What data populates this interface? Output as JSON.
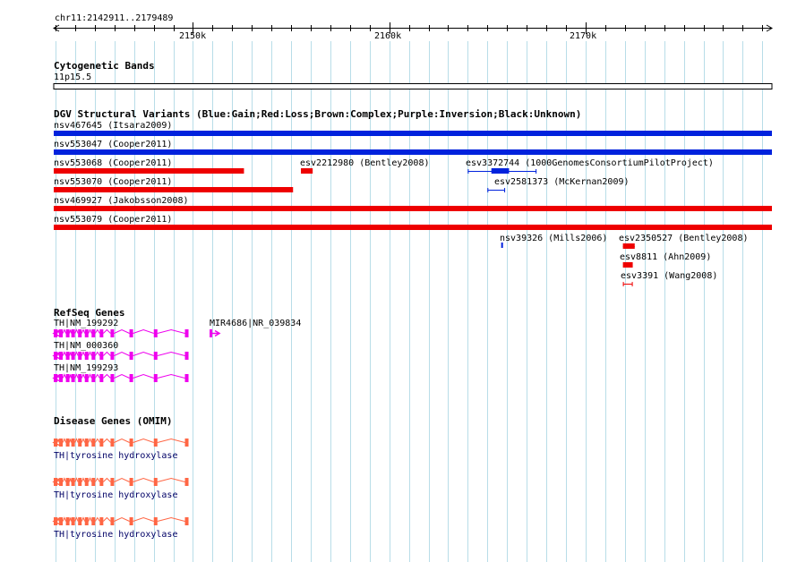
{
  "locus": "chr11:2142911..2179489",
  "ruler": {
    "start": 2142911,
    "end": 2179489,
    "ticks": [
      {
        "pos": 2150000,
        "label": "2150k"
      },
      {
        "pos": 2160000,
        "label": "2160k"
      },
      {
        "pos": 2170000,
        "label": "2170k"
      }
    ]
  },
  "cytoband": {
    "title": "Cytogenetic Bands",
    "label": "11p15.5"
  },
  "dgv": {
    "title": "DGV Structural Variants (Blue:Gain;Red:Loss;Brown:Complex;Purple:Inversion;Black:Unknown)",
    "colors": {
      "gain": "#0022dd",
      "loss": "#ee0000"
    },
    "features": [
      {
        "label": "nsv467645 (Itsara2009)",
        "type": "gain",
        "start": 2142911,
        "end": 2179489
      },
      {
        "label": "nsv553047 (Cooper2011)",
        "type": "gain",
        "start": 2142911,
        "end": 2179489
      },
      {
        "label": "nsv553068 (Cooper2011)",
        "type": "loss",
        "start": 2142911,
        "end": 2152600
      },
      {
        "label": "esv2212980 (Bentley2008)",
        "type": "loss",
        "start": 2155500,
        "end": 2156100
      },
      {
        "label": "esv3372744 (1000GenomesConsortiumPilotProject)",
        "type": "gain",
        "start": 2164000,
        "end": 2167500
      },
      {
        "label": "nsv553070 (Cooper2011)",
        "type": "loss",
        "start": 2142911,
        "end": 2155100
      },
      {
        "label": "esv2581373 (McKernan2009)",
        "type": "gain",
        "start": 2165000,
        "end": 2165900
      },
      {
        "label": "nsv469927 (Jakobsson2008)",
        "type": "loss",
        "start": 2142911,
        "end": 2179489
      },
      {
        "label": "nsv553079 (Cooper2011)",
        "type": "loss",
        "start": 2142911,
        "end": 2179489
      },
      {
        "label": "nsv39326 (Mills2006)",
        "type": "gain",
        "start": 2165700,
        "end": 2165760
      },
      {
        "label": "esv2350527 (Bentley2008)",
        "type": "loss",
        "start": 2171900,
        "end": 2172500
      },
      {
        "label": "esv8811 (Ahn2009)",
        "type": "loss",
        "start": 2171900,
        "end": 2172400
      },
      {
        "label": "esv3391 (Wang2008)",
        "type": "loss",
        "start": 2171900,
        "end": 2172400
      }
    ]
  },
  "refseq": {
    "title": "RefSeq Genes",
    "color": "#ee00ee",
    "genes": [
      {
        "label": "TH|NM_199292",
        "strand": "-",
        "start": 2142911,
        "end": 2149800
      },
      {
        "label": "MIR4686|NR_039834",
        "strand": "+",
        "start": 2150850,
        "end": 2151350
      },
      {
        "label": "TH|NM_000360",
        "strand": "-",
        "start": 2142911,
        "end": 2149800
      },
      {
        "label": "TH|NM_199293",
        "strand": "-",
        "start": 2142911,
        "end": 2149800
      }
    ]
  },
  "omim": {
    "title": "Disease Genes (OMIM)",
    "color": "#ff6644",
    "genes": [
      {
        "label": "TH|tyrosine hydroxylase",
        "strand": "-",
        "start": 2142911,
        "end": 2149800
      },
      {
        "label": "TH|tyrosine hydroxylase",
        "strand": "-",
        "start": 2142911,
        "end": 2149800
      },
      {
        "label": "TH|tyrosine hydroxylase",
        "strand": "-",
        "start": 2142911,
        "end": 2149800
      }
    ]
  }
}
